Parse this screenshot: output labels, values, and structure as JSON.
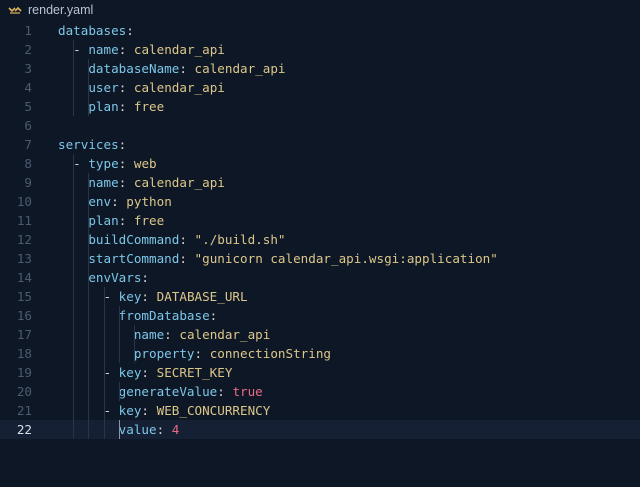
{
  "tab": {
    "filename": "render.yaml",
    "icon": "yaml-file-icon"
  },
  "colors": {
    "background": "#0e1726",
    "key": "#7cc7e8",
    "value": "#dcc78a",
    "boolean": "#ec6a84"
  },
  "current_line": 22,
  "lines": [
    {
      "num": "1",
      "indent": "",
      "dash": "",
      "key": "databases",
      "value": "",
      "vtype": ""
    },
    {
      "num": "2",
      "indent": "  ",
      "dash": "- ",
      "key": "name",
      "value": "calendar_api",
      "vtype": "str"
    },
    {
      "num": "3",
      "indent": "    ",
      "dash": "",
      "key": "databaseName",
      "value": "calendar_api",
      "vtype": "str"
    },
    {
      "num": "4",
      "indent": "    ",
      "dash": "",
      "key": "user",
      "value": "calendar_api",
      "vtype": "str"
    },
    {
      "num": "5",
      "indent": "    ",
      "dash": "",
      "key": "plan",
      "value": "free",
      "vtype": "str"
    },
    {
      "num": "6",
      "indent": "",
      "dash": "",
      "key": "",
      "value": "",
      "vtype": ""
    },
    {
      "num": "7",
      "indent": "",
      "dash": "",
      "key": "services",
      "value": "",
      "vtype": ""
    },
    {
      "num": "8",
      "indent": "  ",
      "dash": "- ",
      "key": "type",
      "value": "web",
      "vtype": "str"
    },
    {
      "num": "9",
      "indent": "    ",
      "dash": "",
      "key": "name",
      "value": "calendar_api",
      "vtype": "str"
    },
    {
      "num": "10",
      "indent": "    ",
      "dash": "",
      "key": "env",
      "value": "python",
      "vtype": "str"
    },
    {
      "num": "11",
      "indent": "    ",
      "dash": "",
      "key": "plan",
      "value": "free",
      "vtype": "str"
    },
    {
      "num": "12",
      "indent": "    ",
      "dash": "",
      "key": "buildCommand",
      "value": "\"./build.sh\"",
      "vtype": "str"
    },
    {
      "num": "13",
      "indent": "    ",
      "dash": "",
      "key": "startCommand",
      "value": "\"gunicorn calendar_api.wsgi:application\"",
      "vtype": "str"
    },
    {
      "num": "14",
      "indent": "    ",
      "dash": "",
      "key": "envVars",
      "value": "",
      "vtype": ""
    },
    {
      "num": "15",
      "indent": "      ",
      "dash": "- ",
      "key": "key",
      "value": "DATABASE_URL",
      "vtype": "str"
    },
    {
      "num": "16",
      "indent": "        ",
      "dash": "",
      "key": "fromDatabase",
      "value": "",
      "vtype": ""
    },
    {
      "num": "17",
      "indent": "          ",
      "dash": "",
      "key": "name",
      "value": "calendar_api",
      "vtype": "str"
    },
    {
      "num": "18",
      "indent": "          ",
      "dash": "",
      "key": "property",
      "value": "connectionString",
      "vtype": "str"
    },
    {
      "num": "19",
      "indent": "      ",
      "dash": "- ",
      "key": "key",
      "value": "SECRET_KEY",
      "vtype": "str"
    },
    {
      "num": "20",
      "indent": "        ",
      "dash": "",
      "key": "generateValue",
      "value": "true",
      "vtype": "bool"
    },
    {
      "num": "21",
      "indent": "      ",
      "dash": "- ",
      "key": "key",
      "value": "WEB_CONCURRENCY",
      "vtype": "str"
    },
    {
      "num": "22",
      "indent": "        ",
      "dash": "",
      "key": "value",
      "value": "4",
      "vtype": "num"
    }
  ]
}
